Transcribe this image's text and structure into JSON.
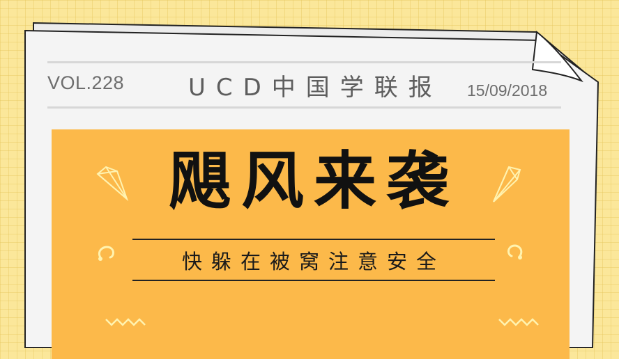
{
  "header": {
    "volume": "VOL.228",
    "masthead": "UCD中国学联报",
    "date": "15/09/2018"
  },
  "main": {
    "headline": "飓风来袭",
    "subtitle": "快躲在被窝注意安全"
  },
  "colors": {
    "background": "#fbe79a",
    "paper": "#f4f4f4",
    "panel": "#fcb94a",
    "text_dark": "#111111",
    "text_grey": "#5d5d5d"
  },
  "icons": [
    "diamond-icon",
    "swirl-icon",
    "zigzag-icon",
    "page-curl-icon"
  ]
}
